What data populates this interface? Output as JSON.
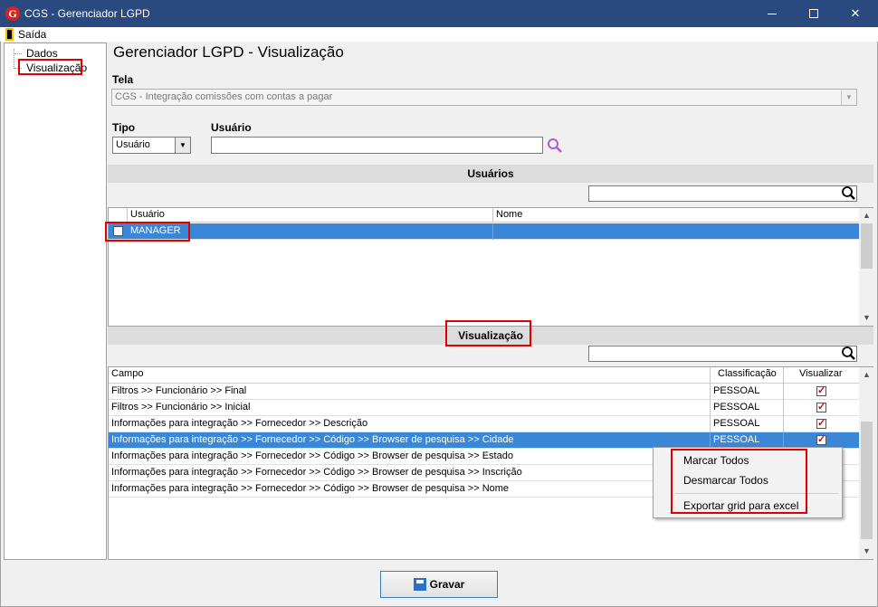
{
  "window": {
    "title": "CGS - Gerenciador LGPD"
  },
  "menu": {
    "exit_label": "Saída"
  },
  "tree": {
    "items": [
      "Dados",
      "Visualização"
    ]
  },
  "page": {
    "title": "Gerenciador LGPD - Visualização"
  },
  "tela": {
    "label": "Tela",
    "value": "CGS - Integração comissões com contas a pagar"
  },
  "tipo": {
    "label": "Tipo",
    "value": "Usuário"
  },
  "usuario": {
    "label": "Usuário",
    "value": ""
  },
  "usuarios_section": {
    "title": "Usuários",
    "search_value": "",
    "columns": [
      "Usuário",
      "Nome"
    ],
    "rows": [
      {
        "usuario": "MANAGER",
        "nome": "",
        "checked": false
      }
    ]
  },
  "visualizacao_section": {
    "title": "Visualização",
    "search_value": "",
    "columns": [
      "Campo",
      "Classificação",
      "Visualizar"
    ],
    "rows": [
      {
        "campo": "Filtros >> Funcionário >> Final",
        "classificacao": "PESSOAL",
        "visualizar": true
      },
      {
        "campo": "Filtros >> Funcionário >> Inicial",
        "classificacao": "PESSOAL",
        "visualizar": true
      },
      {
        "campo": "Informações para integração >> Fornecedor  >> Descrição",
        "classificacao": "PESSOAL",
        "visualizar": true
      },
      {
        "campo": "Informações para integração >> Fornecedor >> Código >> Browser de pesquisa >> Cidade",
        "classificacao": "PESSOAL",
        "visualizar": true
      },
      {
        "campo": "Informações para integração >> Fornecedor >> Código >> Browser de pesquisa >> Estado",
        "classificacao": "",
        "visualizar": null
      },
      {
        "campo": "Informações para integração >> Fornecedor >> Código >> Browser de pesquisa >> Inscrição",
        "classificacao": "",
        "visualizar": null
      },
      {
        "campo": "Informações para integração >> Fornecedor >> Código >> Browser de pesquisa >> Nome",
        "classificacao": "",
        "visualizar": null
      }
    ]
  },
  "context_menu": {
    "items": [
      "Marcar Todos",
      "Desmarcar Todos",
      "Exportar grid para excel"
    ]
  },
  "buttons": {
    "save_label": "Gravar"
  },
  "colors": {
    "titlebar": "#2a4a7f",
    "selection": "#3a87d7",
    "highlight": "#e00000"
  }
}
